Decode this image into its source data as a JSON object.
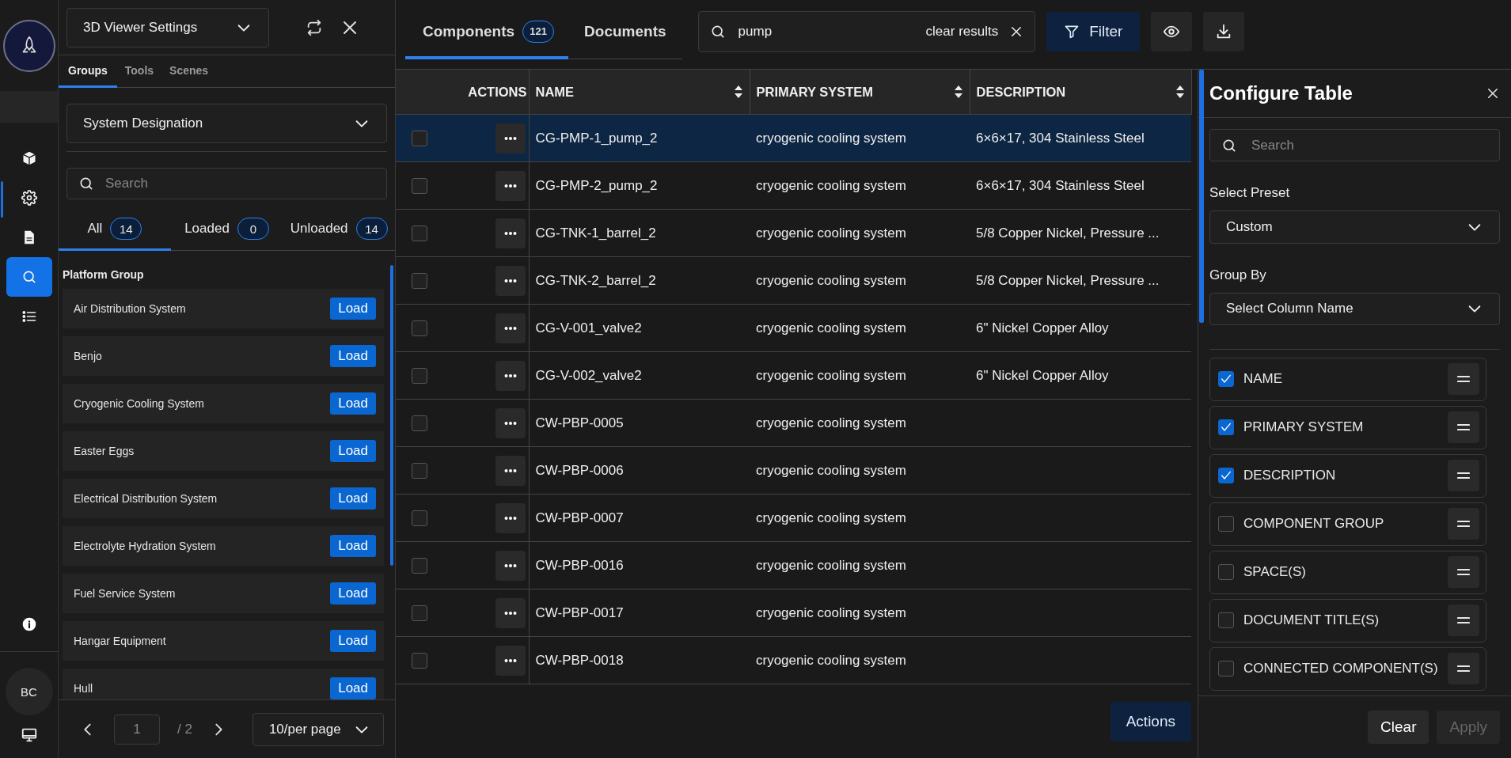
{
  "rail": {
    "nav": [
      {
        "kind": "cube",
        "selected": false,
        "highlighted": false
      },
      {
        "kind": "gear",
        "selected": false,
        "highlighted": true
      },
      {
        "kind": "document",
        "selected": false,
        "highlighted": false
      },
      {
        "kind": "search",
        "selected": true,
        "highlighted": false
      },
      {
        "kind": "list",
        "selected": false,
        "highlighted": false
      }
    ],
    "avatar": "BC"
  },
  "left_panel": {
    "view_select": "3D Viewer Settings",
    "tabs": [
      {
        "label": "Groups",
        "selected": true
      },
      {
        "label": "Tools",
        "selected": false
      },
      {
        "label": "Scenes",
        "selected": false
      }
    ],
    "group_select": "System Designation",
    "search": {
      "placeholder": "Search"
    },
    "filters": [
      {
        "label": "All",
        "count": "14",
        "selected": true
      },
      {
        "label": "Loaded",
        "count": "0",
        "selected": false
      },
      {
        "label": "Unloaded",
        "count": "14",
        "selected": false
      }
    ],
    "section_title": "Platform Group",
    "groups": [
      {
        "name": "Air Distribution System",
        "action": "Load"
      },
      {
        "name": "Benjo",
        "action": "Load"
      },
      {
        "name": "Cryogenic Cooling System",
        "action": "Load"
      },
      {
        "name": "Easter Eggs",
        "action": "Load"
      },
      {
        "name": "Electrical Distribution System",
        "action": "Load"
      },
      {
        "name": "Electrolyte Hydration System",
        "action": "Load"
      },
      {
        "name": "Fuel Service System",
        "action": "Load"
      },
      {
        "name": "Hangar Equipment",
        "action": "Load"
      },
      {
        "name": "Hull",
        "action": "Load"
      }
    ],
    "pagination": {
      "page": "1",
      "total": "/ 2",
      "per_page": "10/per page"
    }
  },
  "main": {
    "tabs": [
      {
        "label": "Components",
        "count": "121",
        "selected": true
      },
      {
        "label": "Documents",
        "selected": false
      }
    ],
    "search": {
      "value": "pump",
      "clear_label": "clear results"
    },
    "filter_button": "Filter",
    "table": {
      "columns": [
        {
          "label": "ACTIONS",
          "sortable": false
        },
        {
          "label": "NAME",
          "sortable": true
        },
        {
          "label": "PRIMARY SYSTEM",
          "sortable": true
        },
        {
          "label": "DESCRIPTION",
          "sortable": true
        }
      ],
      "rows": [
        {
          "name": "CG-PMP-1_pump_2",
          "system": "cryogenic cooling system",
          "description": "6×6×17, 304 Stainless Steel",
          "selected": true,
          "checked": false
        },
        {
          "name": "CG-PMP-2_pump_2",
          "system": "cryogenic cooling system",
          "description": "6×6×17, 304 Stainless Steel",
          "selected": false,
          "checked": false
        },
        {
          "name": "CG-TNK-1_barrel_2",
          "system": "cryogenic cooling system",
          "description": "5/8 Copper Nickel, Pressure ...",
          "selected": false,
          "checked": false
        },
        {
          "name": "CG-TNK-2_barrel_2",
          "system": "cryogenic cooling system",
          "description": "5/8 Copper Nickel, Pressure ...",
          "selected": false,
          "checked": false
        },
        {
          "name": "CG-V-001_valve2",
          "system": "cryogenic cooling system",
          "description": "6\" Nickel Copper Alloy",
          "selected": false,
          "checked": false
        },
        {
          "name": "CG-V-002_valve2",
          "system": "cryogenic cooling system",
          "description": "6\" Nickel Copper Alloy",
          "selected": false,
          "checked": false
        },
        {
          "name": "CW-PBP-0005",
          "system": "cryogenic cooling system",
          "selected": false,
          "checked": false
        },
        {
          "name": "CW-PBP-0006",
          "system": "cryogenic cooling system",
          "selected": false,
          "checked": false
        },
        {
          "name": "CW-PBP-0007",
          "system": "cryogenic cooling system",
          "selected": false,
          "checked": false
        },
        {
          "name": "CW-PBP-0016",
          "system": "cryogenic cooling system",
          "selected": false,
          "checked": false
        },
        {
          "name": "CW-PBP-0017",
          "system": "cryogenic cooling system",
          "selected": false,
          "checked": false
        },
        {
          "name": "CW-PBP-0018",
          "system": "cryogenic cooling system",
          "selected": false,
          "checked": false
        }
      ]
    },
    "actions_button": "Actions"
  },
  "configure_panel": {
    "title": "Configure Table",
    "search": {
      "placeholder": "Search"
    },
    "preset_label": "Select Preset",
    "preset_value": "Custom",
    "group_by_label": "Group By",
    "group_by_value": "Select Column Name",
    "columns": [
      {
        "label": "NAME",
        "checked": true
      },
      {
        "label": "PRIMARY SYSTEM",
        "checked": true
      },
      {
        "label": "DESCRIPTION",
        "checked": true
      },
      {
        "label": "COMPONENT GROUP",
        "checked": false
      },
      {
        "label": "SPACE(S)",
        "checked": false
      },
      {
        "label": "DOCUMENT TITLE(S)",
        "checked": false
      },
      {
        "label": "CONNECTED COMPONENT(S)",
        "checked": false
      }
    ],
    "buttons": [
      {
        "label": "Clear",
        "disabled": false
      },
      {
        "label": "Apply",
        "disabled": true
      }
    ]
  }
}
